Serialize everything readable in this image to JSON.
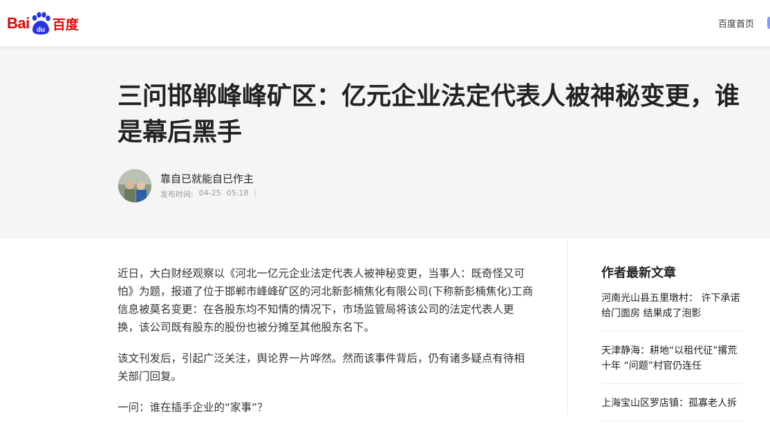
{
  "header": {
    "logo_left": "Bai",
    "logo_paw": "du",
    "logo_cn": "百度",
    "home_link": "百度首页"
  },
  "article": {
    "title": "三问邯郸峰峰矿区：亿元企业法定代表人被神秘变更，谁是幕后黑手",
    "author": "靠自已就能自已作主",
    "publish_label": "发布时间:",
    "date": "04-25",
    "time": "05:18",
    "paragraphs": [
      "近日，大白财经观察以《河北一亿元企业法定代表人被神秘变更，当事人：既奇怪又可怕》为题，报道了位于邯郸市峰峰矿区的河北新彭楠焦化有限公司(下称新彭楠焦化)工商信息被莫名变更：在各股东均不知情的情况下，市场监管局将该公司的法定代表人更换，该公司既有股东的股份也被分摊至其他股东名下。",
      "该文刊发后，引起广泛关注，舆论界一片哗然。然而该事件背后，仍有诸多疑点有待相关部门回复。",
      "一问：谁在插手企业的“家事”？"
    ]
  },
  "sidebar": {
    "heading": "作者最新文章",
    "items": [
      "河南光山县五里墩村： 许下承诺给门面房 结果成了泡影",
      "天津静海：耕地“以租代征”撂荒十年 “问题”村官仍连任",
      "上海宝山区罗店镇：孤寡老人拆"
    ]
  },
  "colors": {
    "brand_red": "#e10601",
    "brand_blue": "#2932e1",
    "hero_bg": "#f5f5f5"
  }
}
